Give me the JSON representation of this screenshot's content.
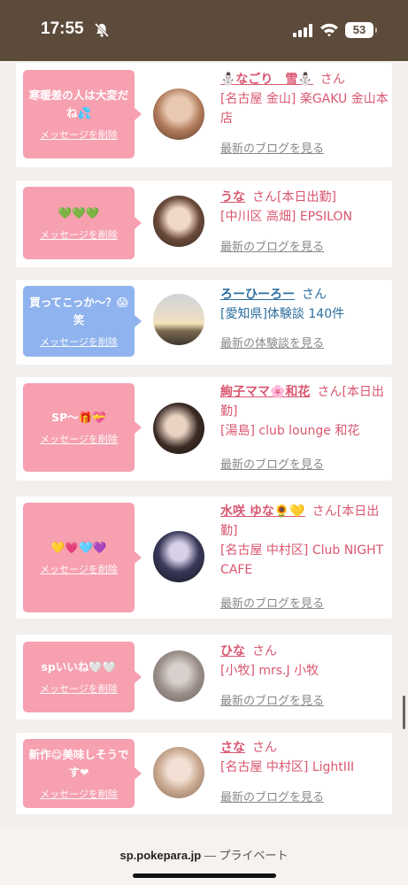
{
  "status_bar": {
    "time": "17:55",
    "battery": "53",
    "icons": [
      "bell-slash-icon",
      "signal-icon",
      "wifi-icon",
      "battery-icon"
    ]
  },
  "delete_label": "メッセージを削除",
  "honorific": "さん",
  "entries": [
    {
      "message": "寒暖差の人は大変だね💦",
      "name": "⛄なごり　雪⛄",
      "honor_suffix": "",
      "shop": "[名古屋 金山] 楽GAKU 金山本店",
      "link": "最新のブログを見る",
      "bubble_color": "#f6a0b0"
    },
    {
      "message": "💚💚💚",
      "name": "うな",
      "honor_suffix": "[本日出勤]",
      "shop": "[中川区 高畑] EPSILON",
      "link": "最新のブログを見る",
      "bubble_color": "#f6a0b0"
    },
    {
      "message": "買ってこっか〜？😱笑",
      "name": "ろーひーろー",
      "honor_suffix": "",
      "shop": "[愛知県]体験談 140件",
      "link": "最新の体験談を見る",
      "bubble_color": "#8fb3ee"
    },
    {
      "message": "SP〜🎁💝",
      "name": "絢子ママ🌸和花",
      "honor_suffix": "[本日出勤]",
      "shop": "[湯島] club lounge 和花",
      "link": "最新のブログを見る",
      "bubble_color": "#f6a0b0"
    },
    {
      "message": "💛💗🩵💜",
      "name": "水咲 ゆな🌻💛",
      "honor_suffix": "[本日出勤]",
      "shop": "[名古屋 中村区] Club NIGHT CAFE",
      "link": "最新のブログを見る",
      "bubble_color": "#f6a0b0"
    },
    {
      "message": "spいいね🤍🤍",
      "name": "ひな",
      "honor_suffix": "",
      "shop": "[小牧] mrs.J 小牧",
      "link": "最新のブログを見る",
      "bubble_color": "#f6a0b0"
    },
    {
      "message": "新作😋美味しそうです❤",
      "name": "さな",
      "honor_suffix": "",
      "shop": "[名古屋 中村区] LightIII",
      "link": "最新のブログを見る",
      "bubble_color": "#f6a0b0"
    }
  ],
  "browser_bar": {
    "domain": "sp.pokepara.jp",
    "separator": "—",
    "mode": "プライベート"
  }
}
